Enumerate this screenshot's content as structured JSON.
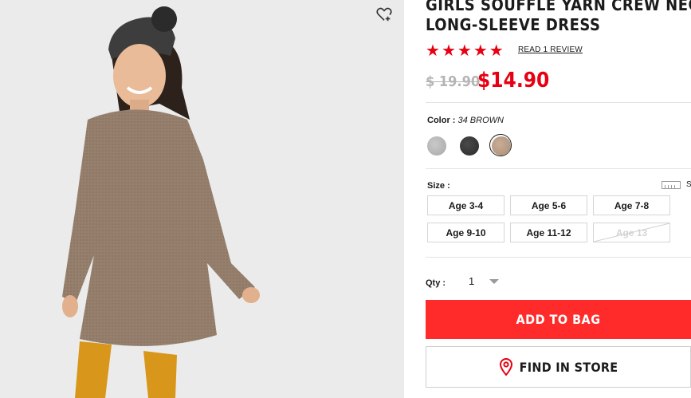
{
  "product": {
    "title_line1": "GIRLS SOUFFLE YARN CREW NECK",
    "title_line2": "LONG-SLEEVE DRESS",
    "rating": 5,
    "review_link": "READ 1 REVIEW",
    "old_price": "$ 19.90",
    "new_price": "$14.90",
    "image_alt_icon": "product-photo"
  },
  "color": {
    "label": "Color :",
    "selected_value": "34 BROWN",
    "swatches": [
      "#b8b8b8",
      "#353535",
      "#b89d88"
    ],
    "selected_index": 2
  },
  "size": {
    "label": "Size :",
    "chart_link": "S",
    "options": [
      "Age 3-4",
      "Age 5-6",
      "Age 7-8",
      "Age 9-10",
      "Age 11-12",
      "Age 13"
    ],
    "unavailable": [
      "Age 13"
    ]
  },
  "quantity": {
    "label": "Qty :",
    "value": "1"
  },
  "actions": {
    "add_to_bag": "ADD TO BAG",
    "find_in_store": "FIND IN STORE"
  },
  "colors": {
    "accent": "#e60012",
    "button": "#ff2b2b"
  }
}
